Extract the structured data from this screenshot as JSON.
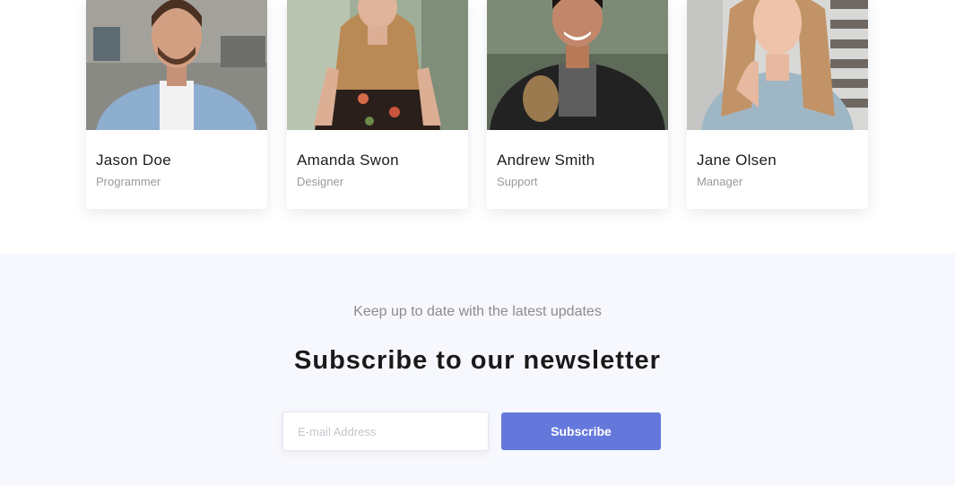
{
  "team": {
    "members": [
      {
        "name": "Jason Doe",
        "role": "Programmer"
      },
      {
        "name": "Amanda Swon",
        "role": "Designer"
      },
      {
        "name": "Andrew Smith",
        "role": "Support"
      },
      {
        "name": "Jane Olsen",
        "role": "Manager"
      }
    ]
  },
  "newsletter": {
    "kicker": "Keep up to date with the latest updates",
    "title": "Subscribe to our newsletter",
    "email_placeholder": "E-mail Address",
    "button_label": "Subscribe"
  },
  "colors": {
    "accent": "#6478dc",
    "newsletter_bg": "#f7f8fd"
  }
}
